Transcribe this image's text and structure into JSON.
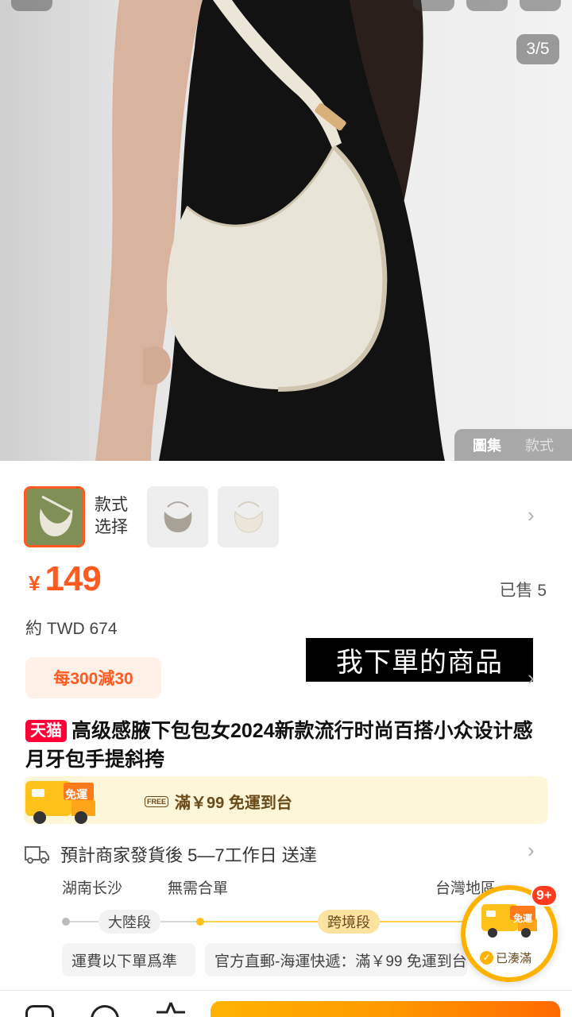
{
  "gallery": {
    "counter": "3/5",
    "tabs": [
      "圖集",
      "款式"
    ]
  },
  "variants": {
    "label": "款式\n選择",
    "label_line1": "款式",
    "label_line2": "选择"
  },
  "price": {
    "currency": "¥",
    "value": "149",
    "sold": "已售 5",
    "twd": "約 TWD 674"
  },
  "promo": {
    "label": "每300減30"
  },
  "caption": {
    "text": "我下單的商品"
  },
  "product": {
    "store_badge": "天猫",
    "title": "高级感腋下包包女2024新款流行时尚百搭小众设计感月牙包手提斜挎"
  },
  "free_shipping": {
    "truck_label": "免運",
    "badge": "FREE",
    "text": "滿￥99 免運到台"
  },
  "shipping": {
    "estimate": "預計商家發貨後 5—7工作日 送達",
    "origin": "湖南长沙",
    "merge": "無需合單",
    "destination": "台灣地區",
    "segment1": "大陸段",
    "segment2": "跨境段",
    "fee1": "運費以下單爲準",
    "fee2": "官方直郵-海運快遞：滿￥99 免運到台"
  },
  "float_widget": {
    "badge": "9+",
    "truck_label": "免運",
    "status": "已湊滿"
  },
  "colors": {
    "accent": "#ff5a1f",
    "tmall": "#ff0036",
    "gold": "#ffb300"
  }
}
